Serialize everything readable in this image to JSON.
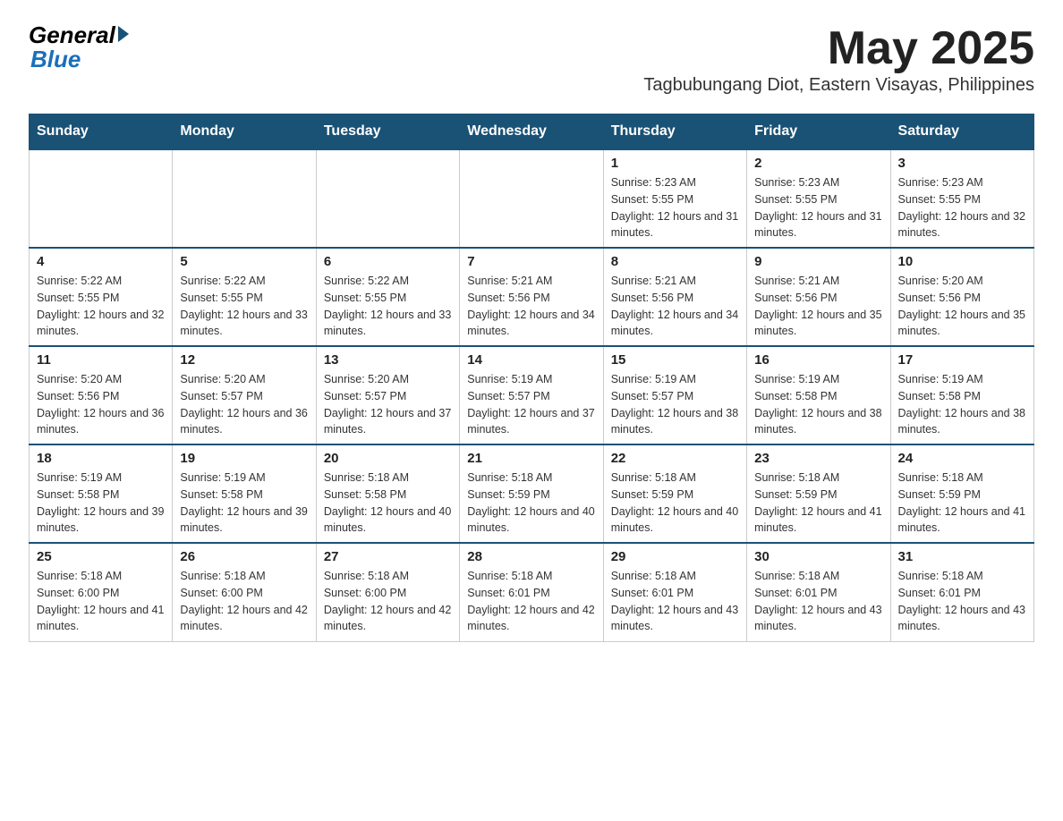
{
  "header": {
    "logo_general": "General",
    "logo_blue": "Blue",
    "month_title": "May 2025",
    "subtitle": "Tagbubungang Diot, Eastern Visayas, Philippines"
  },
  "days_of_week": [
    "Sunday",
    "Monday",
    "Tuesday",
    "Wednesday",
    "Thursday",
    "Friday",
    "Saturday"
  ],
  "weeks": [
    [
      {
        "day": "",
        "info": ""
      },
      {
        "day": "",
        "info": ""
      },
      {
        "day": "",
        "info": ""
      },
      {
        "day": "",
        "info": ""
      },
      {
        "day": "1",
        "info": "Sunrise: 5:23 AM\nSunset: 5:55 PM\nDaylight: 12 hours and 31 minutes."
      },
      {
        "day": "2",
        "info": "Sunrise: 5:23 AM\nSunset: 5:55 PM\nDaylight: 12 hours and 31 minutes."
      },
      {
        "day": "3",
        "info": "Sunrise: 5:23 AM\nSunset: 5:55 PM\nDaylight: 12 hours and 32 minutes."
      }
    ],
    [
      {
        "day": "4",
        "info": "Sunrise: 5:22 AM\nSunset: 5:55 PM\nDaylight: 12 hours and 32 minutes."
      },
      {
        "day": "5",
        "info": "Sunrise: 5:22 AM\nSunset: 5:55 PM\nDaylight: 12 hours and 33 minutes."
      },
      {
        "day": "6",
        "info": "Sunrise: 5:22 AM\nSunset: 5:55 PM\nDaylight: 12 hours and 33 minutes."
      },
      {
        "day": "7",
        "info": "Sunrise: 5:21 AM\nSunset: 5:56 PM\nDaylight: 12 hours and 34 minutes."
      },
      {
        "day": "8",
        "info": "Sunrise: 5:21 AM\nSunset: 5:56 PM\nDaylight: 12 hours and 34 minutes."
      },
      {
        "day": "9",
        "info": "Sunrise: 5:21 AM\nSunset: 5:56 PM\nDaylight: 12 hours and 35 minutes."
      },
      {
        "day": "10",
        "info": "Sunrise: 5:20 AM\nSunset: 5:56 PM\nDaylight: 12 hours and 35 minutes."
      }
    ],
    [
      {
        "day": "11",
        "info": "Sunrise: 5:20 AM\nSunset: 5:56 PM\nDaylight: 12 hours and 36 minutes."
      },
      {
        "day": "12",
        "info": "Sunrise: 5:20 AM\nSunset: 5:57 PM\nDaylight: 12 hours and 36 minutes."
      },
      {
        "day": "13",
        "info": "Sunrise: 5:20 AM\nSunset: 5:57 PM\nDaylight: 12 hours and 37 minutes."
      },
      {
        "day": "14",
        "info": "Sunrise: 5:19 AM\nSunset: 5:57 PM\nDaylight: 12 hours and 37 minutes."
      },
      {
        "day": "15",
        "info": "Sunrise: 5:19 AM\nSunset: 5:57 PM\nDaylight: 12 hours and 38 minutes."
      },
      {
        "day": "16",
        "info": "Sunrise: 5:19 AM\nSunset: 5:58 PM\nDaylight: 12 hours and 38 minutes."
      },
      {
        "day": "17",
        "info": "Sunrise: 5:19 AM\nSunset: 5:58 PM\nDaylight: 12 hours and 38 minutes."
      }
    ],
    [
      {
        "day": "18",
        "info": "Sunrise: 5:19 AM\nSunset: 5:58 PM\nDaylight: 12 hours and 39 minutes."
      },
      {
        "day": "19",
        "info": "Sunrise: 5:19 AM\nSunset: 5:58 PM\nDaylight: 12 hours and 39 minutes."
      },
      {
        "day": "20",
        "info": "Sunrise: 5:18 AM\nSunset: 5:58 PM\nDaylight: 12 hours and 40 minutes."
      },
      {
        "day": "21",
        "info": "Sunrise: 5:18 AM\nSunset: 5:59 PM\nDaylight: 12 hours and 40 minutes."
      },
      {
        "day": "22",
        "info": "Sunrise: 5:18 AM\nSunset: 5:59 PM\nDaylight: 12 hours and 40 minutes."
      },
      {
        "day": "23",
        "info": "Sunrise: 5:18 AM\nSunset: 5:59 PM\nDaylight: 12 hours and 41 minutes."
      },
      {
        "day": "24",
        "info": "Sunrise: 5:18 AM\nSunset: 5:59 PM\nDaylight: 12 hours and 41 minutes."
      }
    ],
    [
      {
        "day": "25",
        "info": "Sunrise: 5:18 AM\nSunset: 6:00 PM\nDaylight: 12 hours and 41 minutes."
      },
      {
        "day": "26",
        "info": "Sunrise: 5:18 AM\nSunset: 6:00 PM\nDaylight: 12 hours and 42 minutes."
      },
      {
        "day": "27",
        "info": "Sunrise: 5:18 AM\nSunset: 6:00 PM\nDaylight: 12 hours and 42 minutes."
      },
      {
        "day": "28",
        "info": "Sunrise: 5:18 AM\nSunset: 6:01 PM\nDaylight: 12 hours and 42 minutes."
      },
      {
        "day": "29",
        "info": "Sunrise: 5:18 AM\nSunset: 6:01 PM\nDaylight: 12 hours and 43 minutes."
      },
      {
        "day": "30",
        "info": "Sunrise: 5:18 AM\nSunset: 6:01 PM\nDaylight: 12 hours and 43 minutes."
      },
      {
        "day": "31",
        "info": "Sunrise: 5:18 AM\nSunset: 6:01 PM\nDaylight: 12 hours and 43 minutes."
      }
    ]
  ]
}
